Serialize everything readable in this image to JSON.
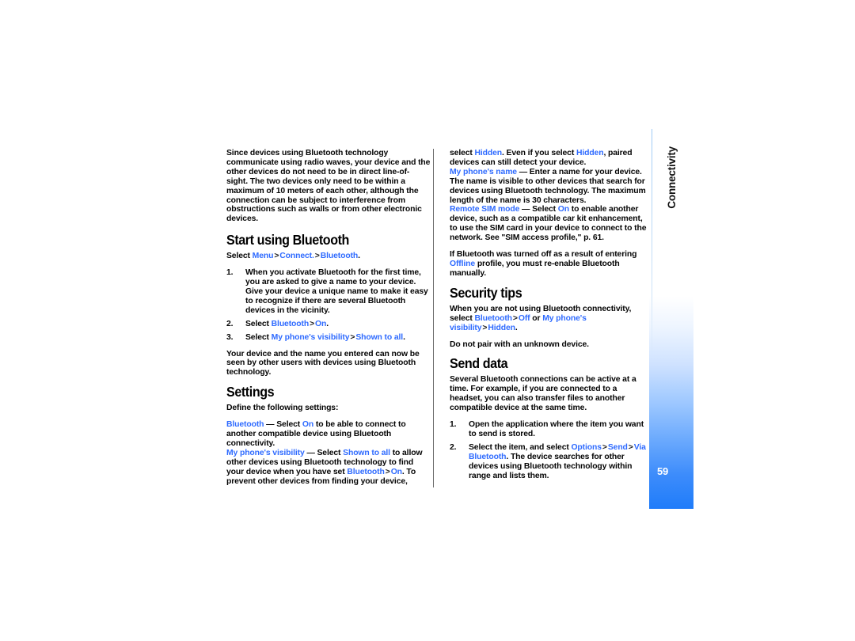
{
  "document": {
    "page_number": "59",
    "section_tab": "Connectivity",
    "accent_color": "#2f6bff",
    "tab_gradient_end": "#1f7cfa"
  },
  "left_column": {
    "intro_paragraph": "Since devices using Bluetooth technology communicate using radio waves, your device and the other devices do not need to be in direct line-of-sight. The two devices only need to be within a maximum of 10 meters of each other, although the connection can be subject to interference from obstructions such as walls or from other electronic devices.",
    "heading_start": "Start using Bluetooth",
    "select_path": {
      "prefix": "Select ",
      "item1": "Menu",
      "sep1": ">",
      "item2": "Connect.",
      "sep2": ">",
      "item3": "Bluetooth",
      "suffix": "."
    },
    "steps": [
      {
        "text": "When you activate Bluetooth for the first time, you are asked to give a name to your device. Give your device a unique name to make it easy to recognize if there are several Bluetooth devices in the vicinity."
      },
      {
        "prefix": "Select ",
        "kw1": "Bluetooth",
        "sep": ">",
        "kw2": "On",
        "suffix": "."
      },
      {
        "prefix": "Select ",
        "kw1": "My phone's visibility",
        "sep": ">",
        "kw2": "Shown to all",
        "suffix": "."
      }
    ],
    "after_steps_paragraph": "Your device and the name you entered can now be seen by other users with devices using Bluetooth technology.",
    "heading_settings": "Settings",
    "settings_lead": "Define the following settings:",
    "setting_bluetooth": {
      "term": "Bluetooth",
      "dash": " — ",
      "text_a": "Select ",
      "value": "On",
      "text_b": " to be able to connect to another compatible device using Bluetooth connectivity."
    },
    "setting_visibility": {
      "term": "My phone's visibility",
      "dash": " — ",
      "text_a": "Select ",
      "value": "Shown to all",
      "text_b": " to allow other devices using Bluetooth technology to find your device when you have set ",
      "kw_bluetooth": "Bluetooth",
      "sep": ">",
      "kw_on": "On",
      "text_c": ". To prevent other devices from finding your device,"
    }
  },
  "right_column": {
    "continued_visibility": {
      "text_a": "select ",
      "kw1": "Hidden",
      "text_b": ". Even if you select ",
      "kw2": "Hidden",
      "text_c": ", paired devices can still detect your device."
    },
    "setting_phone_name": {
      "term": "My phone's name",
      "dash": " — ",
      "text": "Enter a name for your device. The name is visible to other devices that search for devices using Bluetooth technology. The maximum length of the name is 30 characters."
    },
    "setting_remote_sim": {
      "term": "Remote SIM mode",
      "dash": " — ",
      "text_a": "Select ",
      "value": "On",
      "text_b": " to enable another device, such as a compatible car kit enhancement, to use the SIM card in your device to connect to the network. See \"SIM access profile,\" p. 61."
    },
    "offline_note": {
      "text_a": "If Bluetooth was turned off as a result of entering ",
      "kw": "Offline",
      "text_b": " profile, you must re-enable Bluetooth manually."
    },
    "heading_security": "Security tips",
    "security_note": {
      "text_a": "When you are not using Bluetooth connectivity, select ",
      "kw1": "Bluetooth",
      "sep1": ">",
      "kw2": "Off",
      "text_b": " or ",
      "kw3": "My phone's visibility",
      "sep2": ">",
      "kw4": "Hidden",
      "text_c": "."
    },
    "security_note2": "Do not pair with an unknown device.",
    "heading_send": "Send data",
    "send_intro": "Several Bluetooth connections can be active at a time. For example, if you are connected to a headset, you can also transfer files to another compatible device at the same time.",
    "send_steps": [
      {
        "text": "Open the application where the item you want to send is stored."
      },
      {
        "prefix": "Select the item, and select ",
        "kw1": "Options",
        "sep1": ">",
        "kw2": "Send",
        "sep2": ">",
        "kw3": "Via Bluetooth",
        "suffix": ". The device searches for other devices using Bluetooth technology within range and lists them."
      }
    ]
  }
}
